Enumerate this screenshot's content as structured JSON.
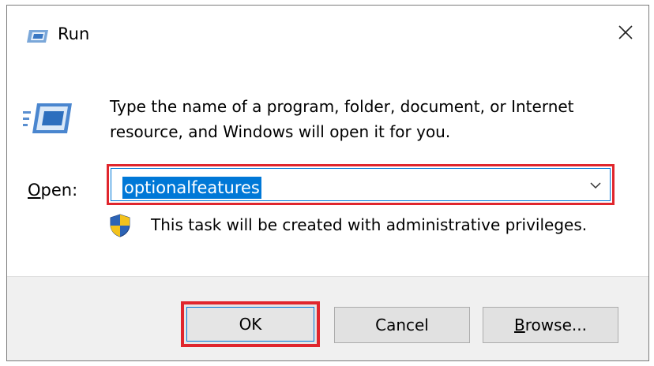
{
  "window": {
    "title": "Run",
    "close_symbol": "✕",
    "title_icon": "run-icon"
  },
  "body": {
    "icon": "run-program-icon",
    "description_line1": "Type the name of a program, folder, document, or Internet",
    "description_line2": "resource, and Windows will open it for you.",
    "open_label_underlined": "O",
    "open_label_rest": "pen:",
    "open_value": "optionalfeatures",
    "admin_note": "This task will be created with administrative privileges.",
    "shield_icon": "uac-shield-icon"
  },
  "buttons": {
    "ok": "OK",
    "cancel": "Cancel",
    "browse_underlined": "B",
    "browse_rest": "rowse..."
  },
  "colors": {
    "highlight_red": "#e0262d",
    "focus_blue": "#0078d7",
    "footer_bg": "#f0f0f0"
  }
}
